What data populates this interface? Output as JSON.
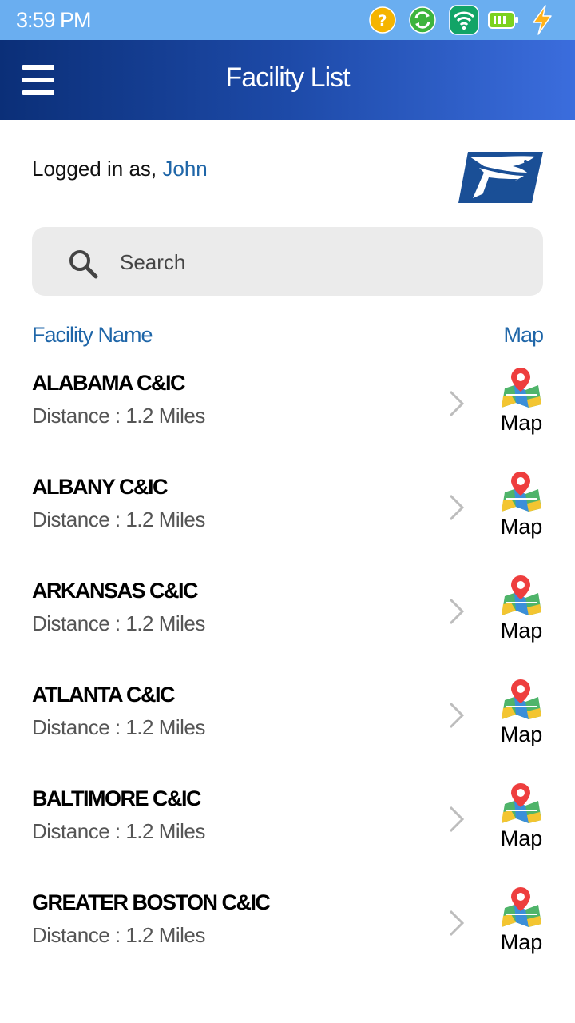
{
  "status_bar": {
    "time": "3:59 PM",
    "icons": [
      "help-circle-icon",
      "sync-icon",
      "wifi-icon",
      "battery-icon",
      "charging-bolt-icon"
    ]
  },
  "header": {
    "title": "Facility List",
    "menu_icon": "hamburger-menu-icon"
  },
  "user": {
    "prefix": "Logged in as, ",
    "name": "John"
  },
  "logo": "usps-eagle-logo",
  "search": {
    "placeholder": "Search",
    "value": ""
  },
  "list_header": {
    "name_label": "Facility Name",
    "map_label": "Map"
  },
  "facilities": [
    {
      "name": "ALABAMA C&IC",
      "distance": "Distance : 1.2 Miles",
      "map_label": "Map"
    },
    {
      "name": "ALBANY C&IC",
      "distance": "Distance : 1.2 Miles",
      "map_label": "Map"
    },
    {
      "name": "ARKANSAS C&IC",
      "distance": "Distance : 1.2 Miles",
      "map_label": "Map"
    },
    {
      "name": "ATLANTA C&IC",
      "distance": "Distance : 1.2 Miles",
      "map_label": "Map"
    },
    {
      "name": "BALTIMORE C&IC",
      "distance": "Distance : 1.2 Miles",
      "map_label": "Map"
    },
    {
      "name": "GREATER BOSTON C&IC",
      "distance": "Distance : 1.2 Miles",
      "map_label": "Map"
    }
  ],
  "colors": {
    "status_bar": "#6aaef0",
    "header_start": "#0b2f78",
    "header_end": "#3b6ddd",
    "accent_blue": "#1f66a8",
    "search_bg": "#ebebeb"
  }
}
